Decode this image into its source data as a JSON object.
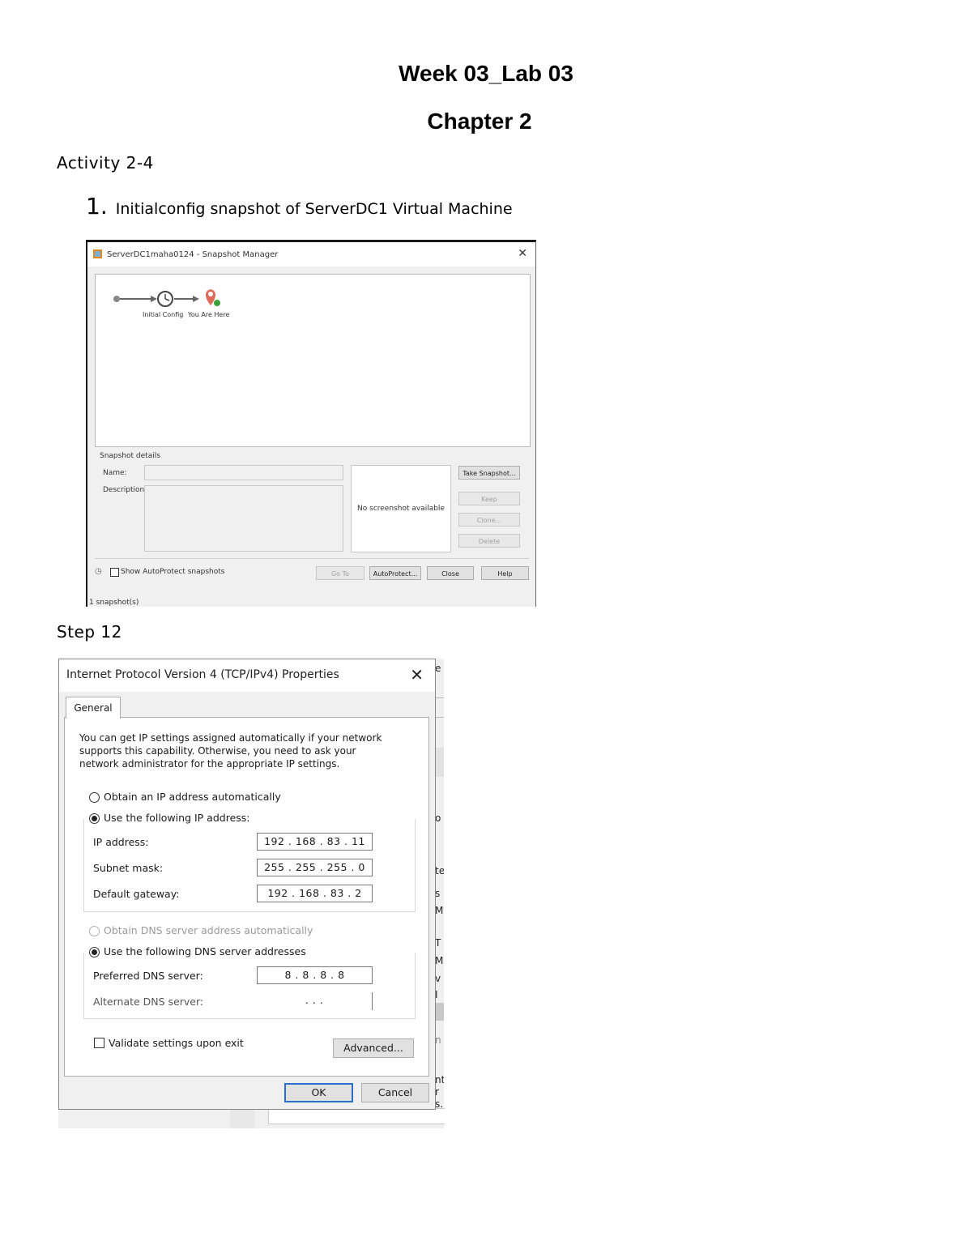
{
  "document": {
    "title": "Week 03_Lab 03",
    "subtitle": "Chapter 2",
    "activity_heading": "Activity 2-4",
    "step1_number": "1.",
    "step1_text": "Initialconfig snapshot of ServerDC1 Virtual Machine",
    "step12_heading": "Step 12"
  },
  "snapshot_manager": {
    "title": "ServerDC1maha0124 - Snapshot Manager",
    "tree_labels": [
      "Initial Config",
      "You Are Here"
    ],
    "details_label": "Snapshot details",
    "name_label": "Name:",
    "description_label": "Description:",
    "no_screenshot": "No screenshot available",
    "buttons": {
      "take_snapshot": "Take Snapshot...",
      "keep": "Keep",
      "clone": "Clone...",
      "delete": "Delete",
      "go_to": "Go To",
      "autoprotect": "AutoProtect...",
      "close": "Close",
      "help": "Help"
    },
    "show_autoprotect": "Show AutoProtect snapshots",
    "status": "1 snapshot(s)"
  },
  "ipv4_dialog": {
    "title": "Internet Protocol Version 4 (TCP/IPv4) Properties",
    "tab": "General",
    "intro": "You can get IP settings assigned automatically if your network supports this capability. Otherwise, you need to ask your network administrator for the appropriate IP settings.",
    "obtain_ip_auto": "Obtain an IP address automatically",
    "use_following_ip": "Use the following IP address:",
    "ip_address_label": "IP address:",
    "ip_address": "192 . 168 . 83 . 11",
    "subnet_mask_label": "Subnet mask:",
    "subnet_mask": "255 . 255 . 255 . 0",
    "default_gateway_label": "Default gateway:",
    "default_gateway": "192 . 168 . 83 . 2",
    "obtain_dns_auto": "Obtain DNS server address automatically",
    "use_following_dns": "Use the following DNS server addresses",
    "preferred_dns_label": "Preferred DNS server:",
    "preferred_dns": "8 . 8 . 8 . 8",
    "alternate_dns_label": "Alternate DNS server:",
    "alternate_dns": ". . .",
    "validate_settings": "Validate settings upon exit",
    "advanced_button": "Advanced...",
    "ok_button": "OK",
    "cancel_button": "Cancel"
  },
  "background_window_fragments": [
    "e",
    "o",
    "te",
    "s",
    "M",
    "T",
    "M",
    "v",
    "I",
    "n",
    "nte",
    "r",
    "s."
  ]
}
